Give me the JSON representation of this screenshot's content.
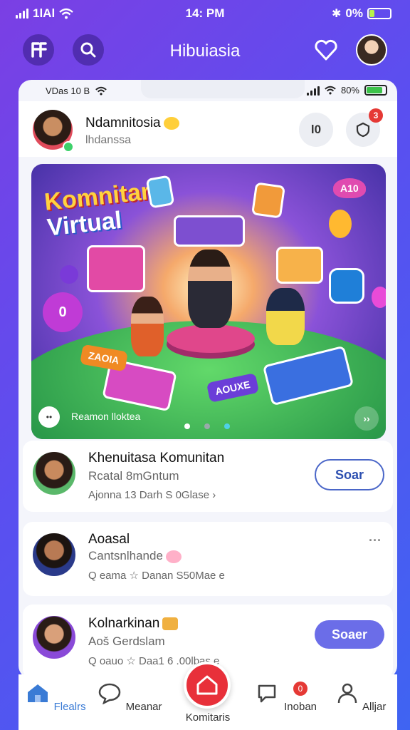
{
  "status_bar": {
    "carrier": "1lAl",
    "time": "14: PM",
    "battery": "0%"
  },
  "header": {
    "title": "Hibuiasia"
  },
  "inner_status": {
    "label": "VDas 10 B",
    "battery": "80%"
  },
  "profile": {
    "name": "Ndamnitosia",
    "subtitle": "lhdanssa",
    "action_label": "l0",
    "badge": "3"
  },
  "banner": {
    "title_line1": "Komnitar",
    "title_line2": "Virtual",
    "caption": "Reamon lloktea",
    "stickers": [
      "ZAOIA",
      "AOUXE",
      "A10",
      "0"
    ],
    "page_count": 3,
    "active_page": 0
  },
  "posts": [
    {
      "name": "Khenuitasa Komunitan",
      "subtitle": "Rcatal 8mGntum",
      "meta": "Ajonna   13 Darh S 0Glase ›",
      "button": "Soar"
    },
    {
      "name": "Aoasal",
      "subtitle": "Cantsnlhande",
      "meta": "Q eama   ☆ Danan S50Mae e",
      "more": "···"
    },
    {
      "name": "Kolnarkinan",
      "subtitle": "Aoš Gerdslam",
      "meta": "Q oauo   ☆ Daa1 6 .00lbas e",
      "button": "Soaer"
    }
  ],
  "nav": {
    "items": [
      {
        "label": "Flealrs",
        "icon": "home-icon",
        "active": true
      },
      {
        "label": "Meanar",
        "icon": "chat-bubble-icon",
        "active": false
      },
      {
        "label": "Komitaris",
        "icon": "home-icon",
        "active": false
      },
      {
        "label": "Inoban",
        "icon": "message-icon",
        "active": false,
        "badge": "0"
      },
      {
        "label": "Alljar",
        "icon": "user-icon",
        "active": false
      }
    ]
  },
  "colors": {
    "accent": "#3a7bd5",
    "fab": "#e8303a",
    "badge": "#e53935",
    "follow_filled": "#6b6de8"
  }
}
